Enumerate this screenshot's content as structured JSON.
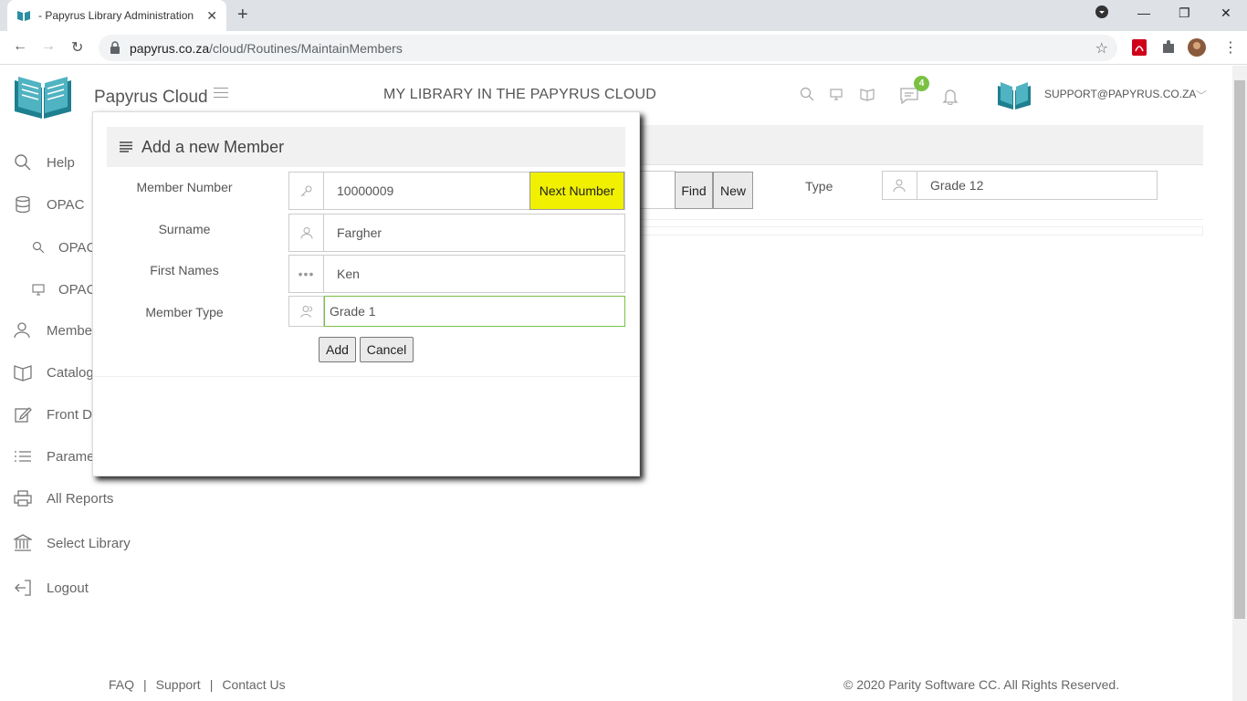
{
  "browser": {
    "tab_title": "- Papyrus Library Administration",
    "url_host": "papyrus.co.za",
    "url_path": "/cloud/Routines/MaintainMembers"
  },
  "header": {
    "brand": "Papyrus Cloud",
    "library_title": "MY LIBRARY IN THE PAPYRUS CLOUD",
    "messages_badge": "4",
    "user_email": "SUPPORT@PAPYRUS.CO.ZA"
  },
  "sidebar": {
    "items": [
      {
        "label": "Help"
      },
      {
        "label": "OPAC"
      },
      {
        "label": "OPAC"
      },
      {
        "label": "OPAC"
      },
      {
        "label": "Membe"
      },
      {
        "label": "Catalog"
      },
      {
        "label": "Front D"
      },
      {
        "label": "Parame"
      },
      {
        "label": "All Reports"
      },
      {
        "label": "Select Library"
      },
      {
        "label": "Logout"
      }
    ]
  },
  "background": {
    "find_label": "Find",
    "new_label": "New",
    "type_label": "Type",
    "type_value": "Grade 12"
  },
  "modal": {
    "title": "Add a new Member",
    "member_number_label": "Member Number",
    "member_number_value": "10000009",
    "next_number_label": "Next Number",
    "surname_label": "Surname",
    "surname_value": "Fargher",
    "first_names_label": "First Names",
    "first_names_value": "Ken",
    "member_type_label": "Member Type",
    "member_type_value": "Grade 1",
    "add_label": "Add",
    "cancel_label": "Cancel"
  },
  "footer": {
    "faq": "FAQ",
    "support": "Support",
    "contact": "Contact Us",
    "copyright": "© 2020 Parity Software CC. All Rights Reserved."
  },
  "colors": {
    "accent_teal": "#2a8fa0",
    "highlight_yellow": "#f0f000",
    "badge_green": "#7ac143"
  }
}
